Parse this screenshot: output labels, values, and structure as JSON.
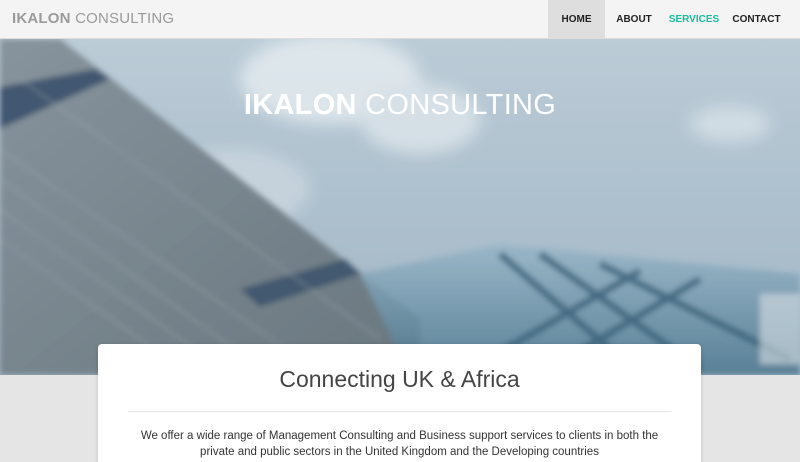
{
  "navbar": {
    "brand_bold": "IKALON",
    "brand_light": " CONSULTING",
    "items": [
      {
        "label": "HOME"
      },
      {
        "label": "ABOUT"
      },
      {
        "label": "SERVICES"
      },
      {
        "label": "CONTACT"
      }
    ],
    "active_item": "HOME",
    "highlight_color": "#1abc9c"
  },
  "hero": {
    "title_bold": "IKALON",
    "title_light": " CONSULTING"
  },
  "intro": {
    "heading": "Connecting UK & Africa",
    "body": "We offer a wide range of Management Consulting and Business support services to clients in both the private and public sectors in the United Kingdom and the Developing countries"
  }
}
